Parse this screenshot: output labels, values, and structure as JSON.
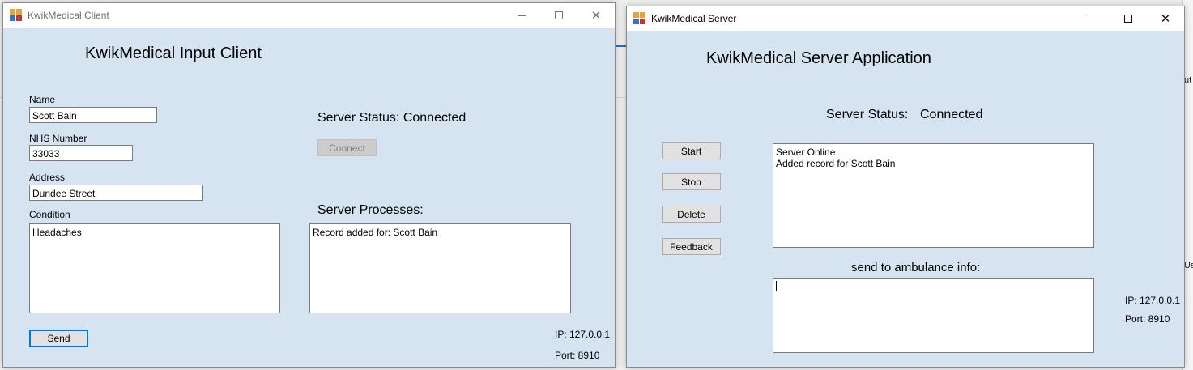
{
  "client": {
    "window_title": "KwikMedical Client",
    "heading": "KwikMedical Input Client",
    "name_label": "Name",
    "name_value": "Scott Bain",
    "nhs_label": "NHS Number",
    "nhs_value": "33033",
    "address_label": "Address",
    "address_value": "Dundee Street",
    "condition_label": "Condition",
    "condition_value": "Headaches",
    "server_status": "Server Status: Connected",
    "connect_label": "Connect",
    "processes_label": "Server Processes:",
    "processes_text": "Record added for: Scott Bain",
    "send_label": "Send",
    "ip_text": "IP: 127.0.0.1",
    "port_text": "Port: 8910"
  },
  "server": {
    "window_title": "KwikMedical Server",
    "heading": "KwikMedical Server Application",
    "status_label": "Server Status:",
    "status_value": "Connected",
    "buttons": {
      "start": "Start",
      "stop": "Stop",
      "delete": "Delete",
      "feedback": "Feedback"
    },
    "log_lines": [
      "Server Online",
      "Added record for Scott Bain"
    ],
    "ambulance_label": "send to ambulance info:",
    "ambulance_value": "",
    "ip_text": "IP:  127.0.0.1",
    "port_text": "Port:  8910"
  },
  "background": {
    "fragment_1": "ut",
    "fragment_2": "Us"
  },
  "colors": {
    "form_background": "#d6e4f1",
    "accent": "#0078d7"
  },
  "icons": {
    "app": "windows-form-icon",
    "minimize": "minimize-icon",
    "maximize": "maximize-icon",
    "close": "close-icon"
  }
}
